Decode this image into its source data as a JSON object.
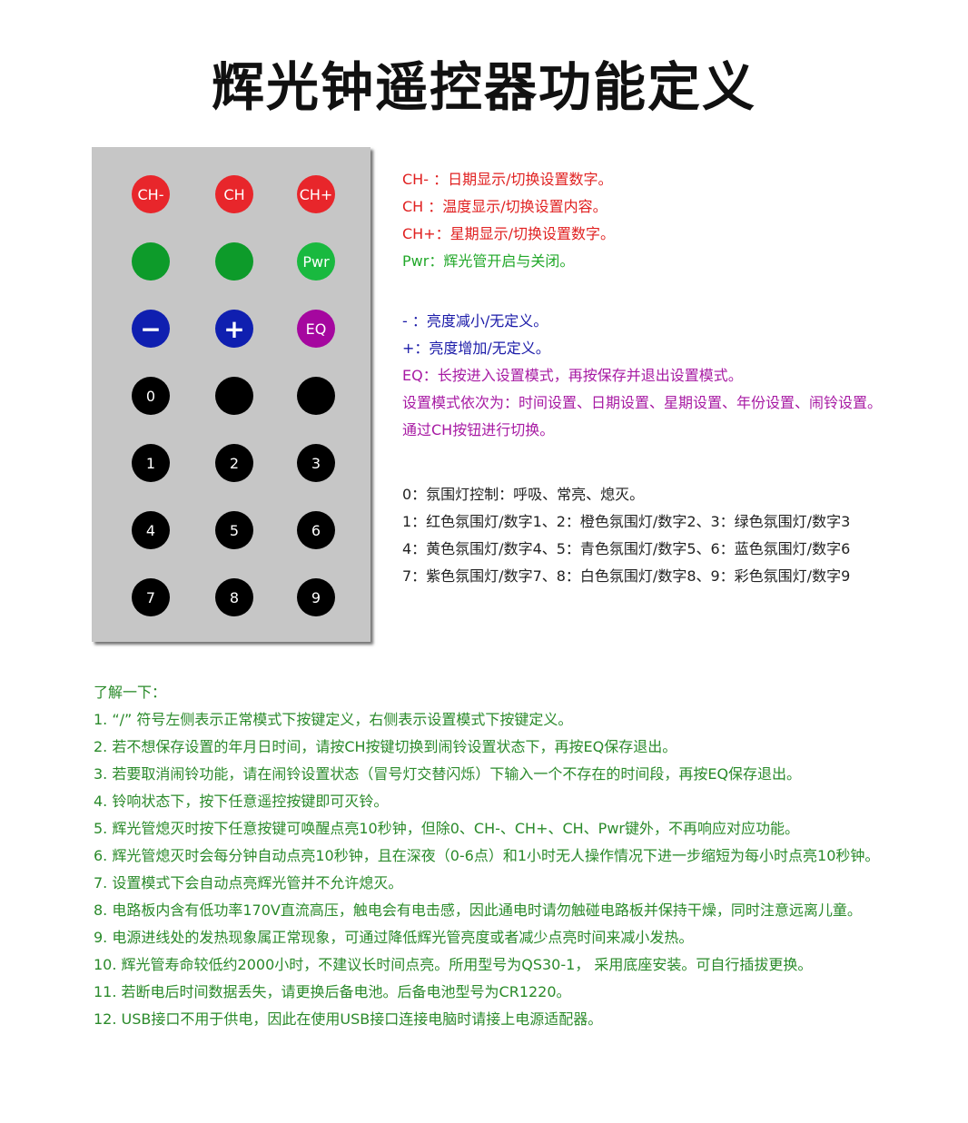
{
  "title": "辉光钟遥控器功能定义",
  "remote": {
    "buttons": [
      {
        "label": "CH-",
        "color": "#e8262b"
      },
      {
        "label": "CH",
        "color": "#e8262b"
      },
      {
        "label": "CH+",
        "color": "#e8262b"
      },
      {
        "label": "",
        "color": "#0d9b2a"
      },
      {
        "label": "",
        "color": "#0d9b2a"
      },
      {
        "label": "Pwr",
        "color": "#19b93f"
      },
      {
        "label": "−",
        "color": "#0f1fb0"
      },
      {
        "label": "+",
        "color": "#0f1fb0"
      },
      {
        "label": "EQ",
        "color": "#a5079f"
      },
      {
        "label": "0",
        "color": "#000000"
      },
      {
        "label": "",
        "color": "#000000"
      },
      {
        "label": "",
        "color": "#000000"
      },
      {
        "label": "1",
        "color": "#000000"
      },
      {
        "label": "2",
        "color": "#000000"
      },
      {
        "label": "3",
        "color": "#000000"
      },
      {
        "label": "4",
        "color": "#000000"
      },
      {
        "label": "5",
        "color": "#000000"
      },
      {
        "label": "6",
        "color": "#000000"
      },
      {
        "label": "7",
        "color": "#000000"
      },
      {
        "label": "8",
        "color": "#000000"
      },
      {
        "label": "9",
        "color": "#000000"
      }
    ]
  },
  "legend": {
    "group1": [
      "CH- ：日期显示/切换设置数字。",
      "CH  ：温度显示/切换设置内容。",
      "CH+：星期显示/切换设置数字。"
    ],
    "group1_pwr": "Pwr：辉光管开启与关闭。",
    "group2_blue": [
      "- ：亮度减小/无定义。",
      "+：亮度增加/无定义。"
    ],
    "group2_purple": [
      "EQ：长按进入设置模式，再按保存并退出设置模式。",
      "设置模式依次为：时间设置、日期设置、星期设置、年份设置、闹铃设置。",
      "通过CH按钮进行切换。"
    ],
    "group3": [
      "0：氛围灯控制：呼吸、常亮、熄灭。",
      "1：红色氛围灯/数字1、2：橙色氛围灯/数字2、3：绿色氛围灯/数字3",
      "4：黄色氛围灯/数字4、5：青色氛围灯/数字5、6：蓝色氛围灯/数字6",
      "7：紫色氛围灯/数字7、8：白色氛围灯/数字8、9：彩色氛围灯/数字9"
    ]
  },
  "notes": {
    "heading": "了解一下：",
    "items": [
      "1.  “/” 符号左侧表示正常模式下按键定义，右侧表示设置模式下按键定义。",
      "2.  若不想保存设置的年月日时间，请按CH按键切换到闹铃设置状态下，再按EQ保存退出。",
      "3.  若要取消闹铃功能，请在闹铃设置状态（冒号灯交替闪烁）下输入一个不存在的时间段，再按EQ保存退出。",
      "4.  铃响状态下，按下任意遥控按键即可灭铃。",
      "5.  辉光管熄灭时按下任意按键可唤醒点亮10秒钟，但除0、CH-、CH+、CH、Pwr键外，不再响应对应功能。",
      "6.  辉光管熄灭时会每分钟自动点亮10秒钟，且在深夜（0-6点）和1小时无人操作情况下进一步缩短为每小时点亮10秒钟。",
      "7.  设置模式下会自动点亮辉光管并不允许熄灭。",
      "8.  电路板内含有低功率170V直流高压，触电会有电击感，因此通电时请勿触碰电路板并保持干燥，同时注意远离儿童。",
      "9.  电源进线处的发热现象属正常现象，可通过降低辉光管亮度或者减少点亮时间来减小发热。",
      "10.  辉光管寿命较低约2000小时，不建议长时间点亮。所用型号为QS30-1， 采用底座安装。可自行插拔更换。",
      "11.  若断电后时间数据丢失，请更换后备电池。后备电池型号为CR1220。",
      "12.  USB接口不用于供电，因此在使用USB接口连接电脑时请接上电源适配器。"
    ]
  }
}
